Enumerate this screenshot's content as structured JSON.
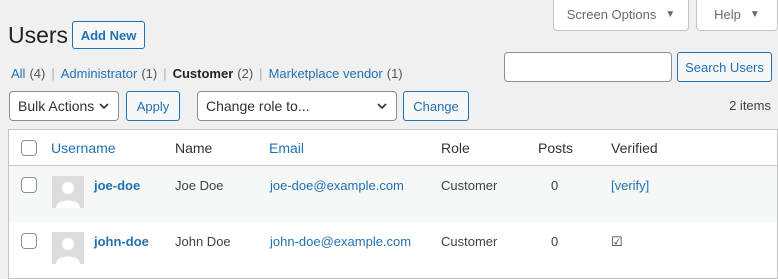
{
  "header": {
    "screen_options": "Screen Options",
    "help": "Help",
    "title": "Users",
    "add_new": "Add New"
  },
  "filters": [
    {
      "label": "All",
      "count": "(4)",
      "current": false
    },
    {
      "label": "Administrator",
      "count": "(1)",
      "current": false
    },
    {
      "label": "Customer",
      "count": "(2)",
      "current": true
    },
    {
      "label": "Marketplace vendor",
      "count": "(1)",
      "current": false
    }
  ],
  "search": {
    "placeholder": "",
    "button": "Search Users"
  },
  "bulk": {
    "select_value": "Bulk Actions",
    "apply": "Apply",
    "role_value": "Change role to...",
    "change": "Change",
    "items_count": "2 items"
  },
  "table": {
    "columns": {
      "username": "Username",
      "name": "Name",
      "email": "Email",
      "role": "Role",
      "posts": "Posts",
      "verified": "Verified"
    },
    "rows": [
      {
        "username": "joe-doe",
        "name": "Joe Doe",
        "email": "joe-doe@example.com",
        "role": "Customer",
        "posts": "0",
        "verified": "[verify]"
      },
      {
        "username": "john-doe",
        "name": "John Doe",
        "email": "john-doe@example.com",
        "role": "Customer",
        "posts": "0",
        "verified": "☑"
      }
    ]
  },
  "colors": {
    "accent": "#2271b1",
    "background": "#f0f0f1",
    "border": "#c3c4c7"
  }
}
